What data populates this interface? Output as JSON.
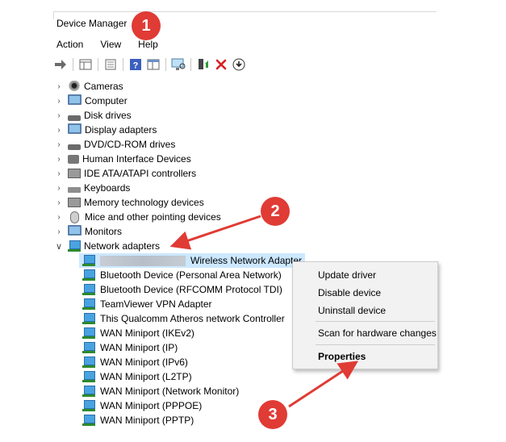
{
  "window": {
    "title": "Device Manager"
  },
  "menu": [
    "Action",
    "View",
    "Help"
  ],
  "toolbar": [
    "back-arrow-icon",
    "forward-arrow-icon",
    "properties-grid-icon",
    "window-icon",
    "help-icon",
    "panel-icon",
    "monitor-scan-icon",
    "update-driver-icon",
    "uninstall-x-icon",
    "download-circle-icon"
  ],
  "tree": {
    "categories": [
      {
        "label": "Cameras",
        "icon": "camera-icon"
      },
      {
        "label": "Computer",
        "icon": "computer-icon"
      },
      {
        "label": "Disk drives",
        "icon": "disk-icon"
      },
      {
        "label": "Display adapters",
        "icon": "display-icon"
      },
      {
        "label": "DVD/CD-ROM drives",
        "icon": "dvd-icon"
      },
      {
        "label": "Human Interface Devices",
        "icon": "hid-icon"
      },
      {
        "label": "IDE ATA/ATAPI controllers",
        "icon": "ide-icon"
      },
      {
        "label": "Keyboards",
        "icon": "keyboard-icon"
      },
      {
        "label": "Memory technology devices",
        "icon": "memory-icon"
      },
      {
        "label": "Mice and other pointing devices",
        "icon": "mouse-icon"
      },
      {
        "label": "Monitors",
        "icon": "monitor-icon"
      },
      {
        "label": "Network adapters",
        "icon": "network-icon"
      }
    ],
    "network_children": [
      {
        "label": "Wireless Network Adapter",
        "redacted": true
      },
      {
        "label": "Bluetooth Device (Personal Area Network)"
      },
      {
        "label": "Bluetooth Device (RFCOMM Protocol TDI)"
      },
      {
        "label": "TeamViewer VPN Adapter"
      },
      {
        "label": "This Qualcomm Atheros network Controller"
      },
      {
        "label": "WAN Miniport (IKEv2)"
      },
      {
        "label": "WAN Miniport (IP)"
      },
      {
        "label": "WAN Miniport (IPv6)"
      },
      {
        "label": "WAN Miniport (L2TP)"
      },
      {
        "label": "WAN Miniport (Network Monitor)"
      },
      {
        "label": "WAN Miniport (PPPOE)"
      },
      {
        "label": "WAN Miniport (PPTP)"
      }
    ]
  },
  "context_menu": {
    "update": "Update driver",
    "disable": "Disable device",
    "uninstall": "Uninstall device",
    "scan": "Scan for hardware changes",
    "properties": "Properties"
  },
  "annotations": [
    "1",
    "2",
    "3"
  ],
  "colors": {
    "badge": "#e03b35",
    "arrow": "#e03b35",
    "selection": "#cce8ff"
  }
}
